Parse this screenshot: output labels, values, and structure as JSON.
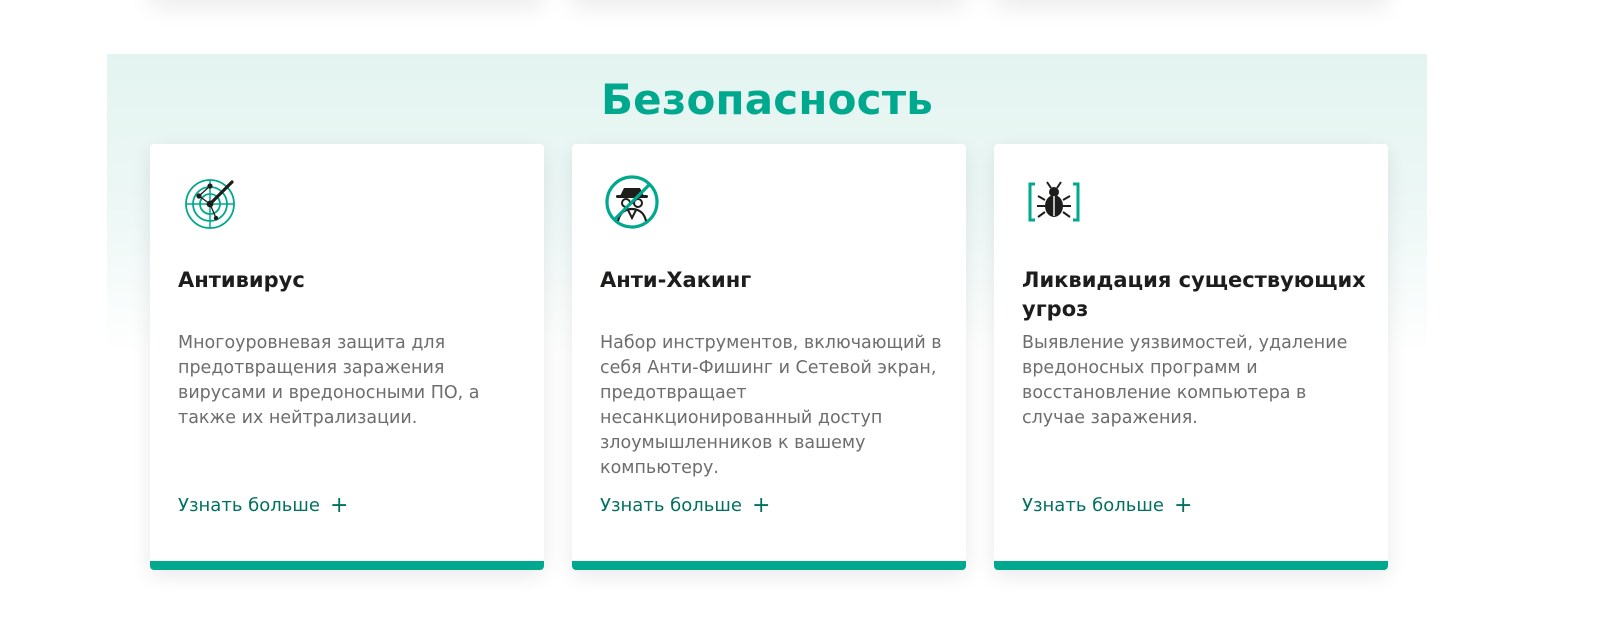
{
  "section": {
    "title": "Безопасность"
  },
  "cards": [
    {
      "icon": "radar-icon",
      "title": "Антивирус",
      "description": "Многоуровневая защита для предотвращения заражения вирусами и вредоносными ПО, а также их нейтрализации.",
      "link_label": "Узнать больше",
      "link_symbol": "+"
    },
    {
      "icon": "anti-hacker-icon",
      "title": "Анти-Хакинг",
      "description": "Набор инструментов, включающий в себя Анти-Фишинг и Сетевой экран, предотвращает несанкционированный доступ злоумышленников к вашему компьютеру.",
      "link_label": "Узнать больше",
      "link_symbol": "+"
    },
    {
      "icon": "bug-in-brackets-icon",
      "title": "Ликвидация существующих угроз",
      "description": "Выявление уязвимостей, удаление вредоносных программ и восстановление компьютера в случае заражения.",
      "link_label": "Узнать больше",
      "link_symbol": "+"
    }
  ],
  "colors": {
    "accent": "#00a88e",
    "link": "#00705f",
    "title_text": "#1d1d1b",
    "body_text": "#6d6d6d",
    "section_bg": "#e3f4f0"
  }
}
